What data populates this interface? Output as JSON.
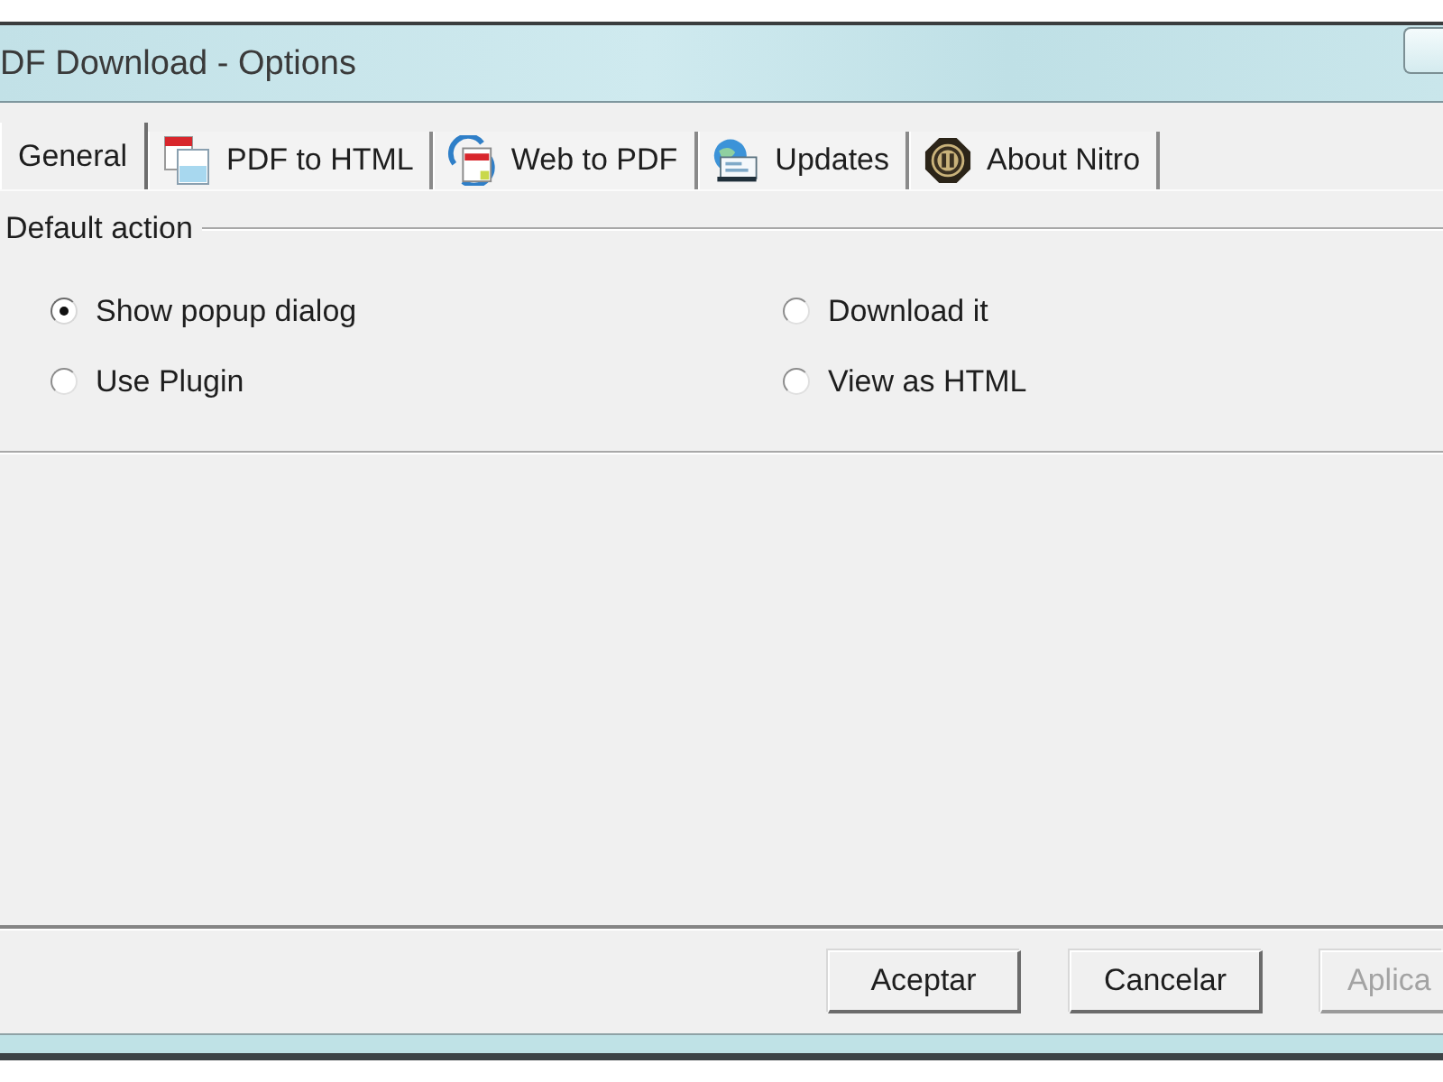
{
  "window": {
    "title": "DF Download - Options"
  },
  "tabs": [
    {
      "label": "General",
      "selected": true
    },
    {
      "label": "PDF to HTML",
      "selected": false
    },
    {
      "label": "Web to PDF",
      "selected": false
    },
    {
      "label": "Updates",
      "selected": false
    },
    {
      "label": "About Nitro",
      "selected": false
    }
  ],
  "group": {
    "label": "Default action",
    "options": [
      {
        "label": "Show popup dialog",
        "selected": true
      },
      {
        "label": "Download it",
        "selected": false
      },
      {
        "label": "Use Plugin",
        "selected": false
      },
      {
        "label": "View as HTML",
        "selected": false
      }
    ]
  },
  "buttons": [
    {
      "label": "Aceptar",
      "disabled": false
    },
    {
      "label": "Cancelar",
      "disabled": false
    },
    {
      "label": "Aplica",
      "disabled": true
    }
  ]
}
